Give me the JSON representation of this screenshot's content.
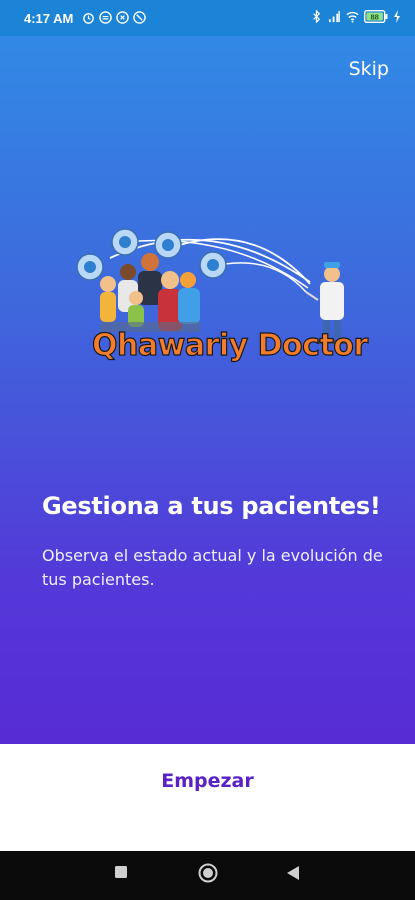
{
  "status_bar": {
    "time": "4:17 AM",
    "left_icons": [
      "alarm-icon",
      "notification-icon",
      "vpn-icon",
      "data-saver-icon"
    ],
    "right_icons": [
      "bluetooth-icon",
      "signal-icon",
      "wifi-icon",
      "battery-icon",
      "charging-icon"
    ],
    "battery_level": "88"
  },
  "onboarding": {
    "skip_label": "Skip",
    "logo_text": "Qhawariy Doctor",
    "title": "Gestiona a tus pacientes!",
    "description": "Observa el estado actual y la evolución de tus pacientes.",
    "start_label": "Empezar"
  },
  "nav_bar": {
    "buttons": [
      "recents-square-icon",
      "home-circle-icon",
      "back-triangle-icon"
    ]
  },
  "colors": {
    "gradient_top": "#2f8ee6",
    "gradient_bottom": "#5b1fd0",
    "accent": "#5a22c4",
    "logo": "#f47c2b"
  }
}
